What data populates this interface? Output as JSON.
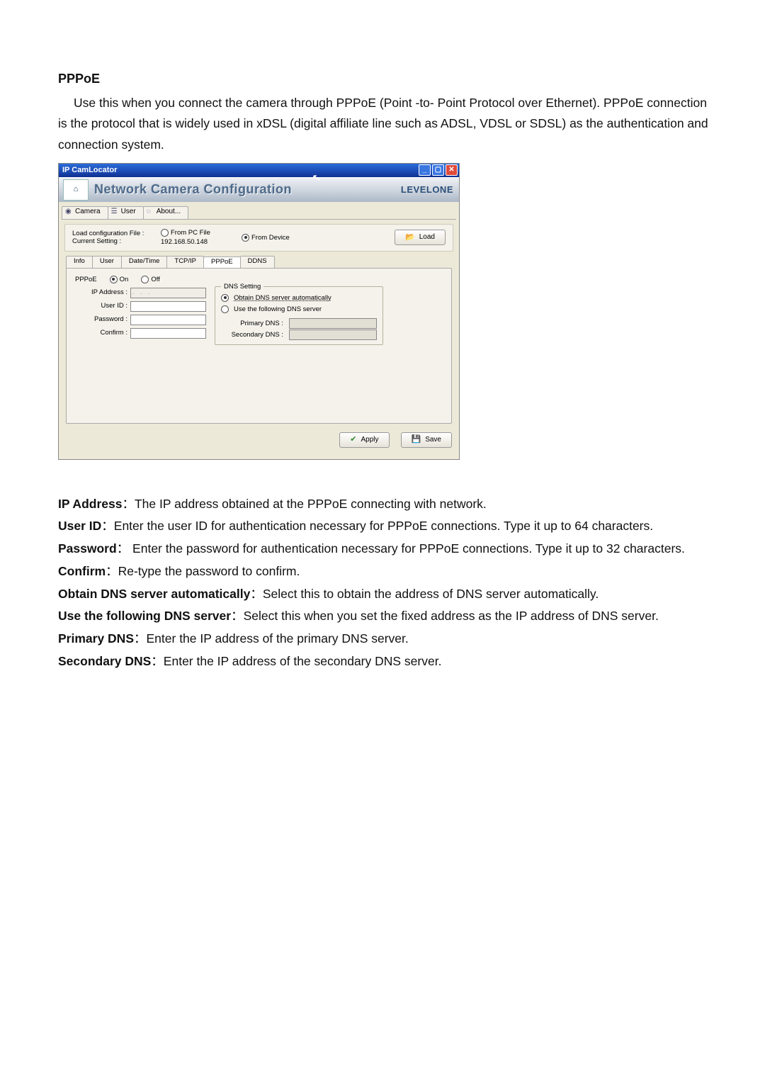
{
  "doc": {
    "heading": "PPPoE",
    "intro": "Use this when you connect the camera through PPPoE (Point -to- Point Protocol over Ethernet). PPPoE connection is the protocol that is widely used in xDSL (digital affiliate line such as ADSL, VDSL or SDSL) as the authentication and connection system."
  },
  "screenshot": {
    "windowTitle": "IP CamLocator",
    "bannerTitle": "Network Camera Configuration",
    "brand": "LEVELONE",
    "topTabs": {
      "camera": "Camera",
      "user": "User",
      "about": "About..."
    },
    "configRow": {
      "loadLabel": "Load configuration File :",
      "currentLabel": "Current Setting :",
      "fromPcFile": "From PC File",
      "fromDevice": "From Device",
      "ip": "192.168.50.148",
      "loadBtn": "Load"
    },
    "subTabs": {
      "info": "Info",
      "user": "User",
      "datetime": "Date/Time",
      "tcpip": "TCP/IP",
      "pppoe": "PPPoE",
      "ddns": "DDNS"
    },
    "panel": {
      "pppoeLabel": "PPPoE",
      "on": "On",
      "off": "Off",
      "ipAddressLabel": "IP Address :",
      "ipAddressValue": ".   .   .",
      "userIdLabel": "User ID :",
      "passwordLabel": "Password :",
      "confirmLabel": "Confirm :",
      "dnsLegend": "DNS Setting",
      "dnsAuto": "Obtain DNS server automatically",
      "dnsManual": "Use the following DNS server",
      "primaryDnsLabel": "Primary DNS :",
      "secondaryDnsLabel": "Secondary DNS :"
    },
    "footer": {
      "apply": "Apply",
      "save": "Save"
    }
  },
  "defs": {
    "ipAddressTerm": "IP Address",
    "ipAddressDesc": "：The IP address obtained at the PPPoE connecting with network.",
    "userIdTerm": "User ID",
    "userIdDesc": "：Enter the user ID for authentication necessary for PPPoE connections. Type it up to 64 characters.",
    "passwordTerm": "Password",
    "passwordDesc": "： Enter the password for authentication necessary for PPPoE connections. Type it up to 32 characters.",
    "confirmTerm": "Confirm",
    "confirmDesc": "：Re-type the password to confirm.",
    "obtainDnsTerm": "Obtain DNS server automatically",
    "obtainDnsDesc": "：Select this to obtain the address of DNS server automatically.",
    "useDnsTerm": "Use the following DNS server",
    "useDnsDesc": "：Select this when you set the fixed address as the IP address of DNS server.",
    "primaryDnsTerm": "Primary DNS",
    "primaryDnsDesc": "：Enter the IP address of the primary DNS server.",
    "secondaryDnsTerm": "Secondary DNS",
    "secondaryDnsDesc": "：Enter the IP address of the secondary DNS server."
  }
}
